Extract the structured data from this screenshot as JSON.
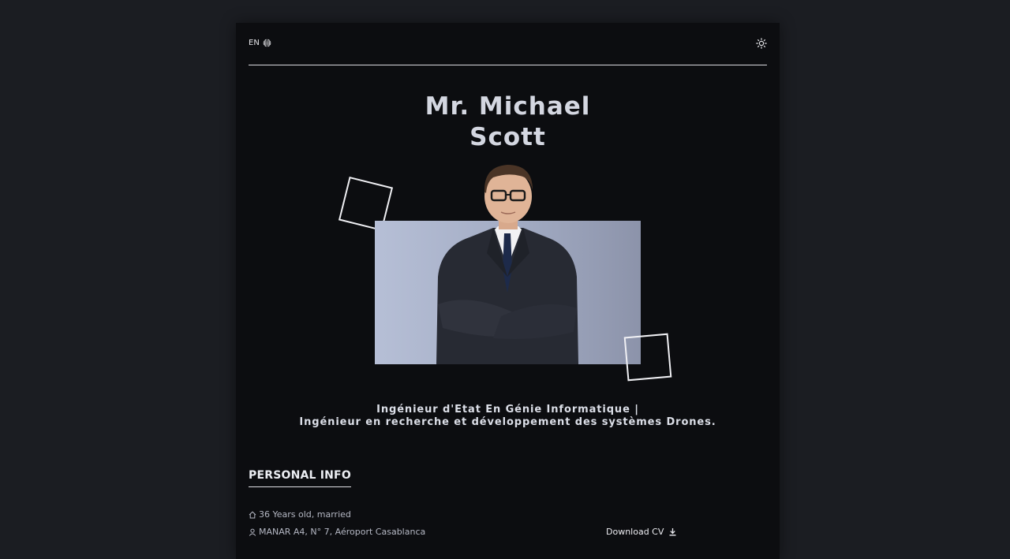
{
  "header": {
    "language_label": "EN",
    "language_icon": "globe-icon",
    "theme_icon": "sun-icon"
  },
  "profile": {
    "name_line1": "Mr. Michael",
    "name_line2": "Scott",
    "subtitle_line1": "Ingénieur d'Etat En Génie Informatique |",
    "subtitle_line2": "Ingénieur en recherche et développement des systèmes Drones."
  },
  "personal_info": {
    "section_title": "PERSONAL INFO",
    "age_status": "36 Years old, married",
    "address": "MANAR A4, N° 7, Aéroport Casablanca",
    "download_label": "Download CV"
  },
  "colors": {
    "page_background": "#1b1d22",
    "card_background": "#0c0d10",
    "name_color": "#d4d7e1",
    "photo_background": "#aab3ca"
  }
}
